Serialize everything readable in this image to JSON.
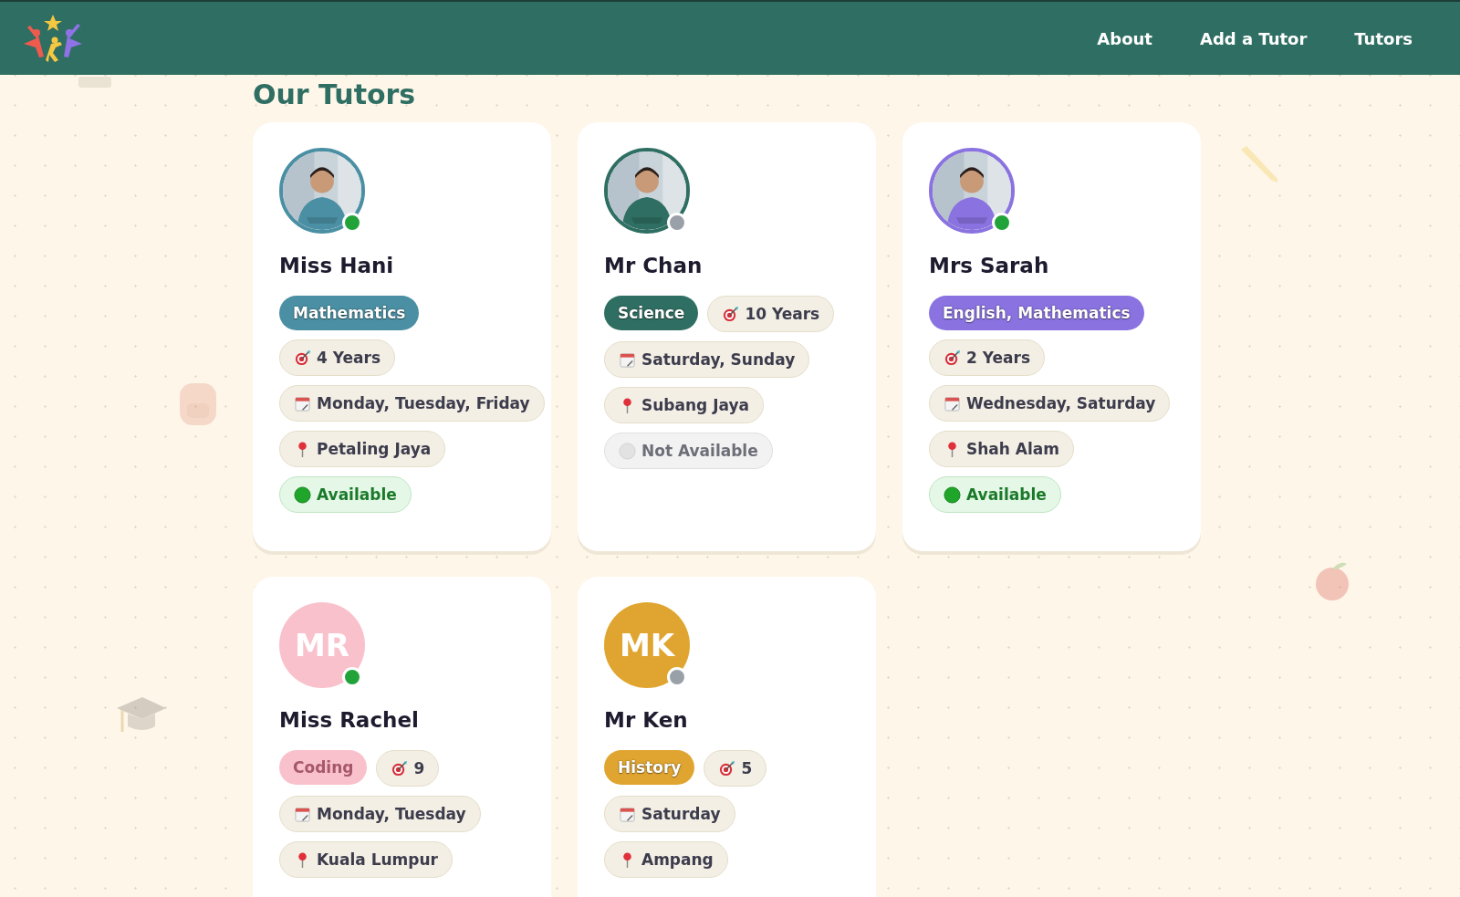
{
  "header": {
    "nav": [
      "About",
      "Add a Tutor",
      "Tutors"
    ]
  },
  "heading": "Our Tutors",
  "tutors": [
    {
      "name": "Miss Hani",
      "avatar": {
        "kind": "picture"
      },
      "color": "#4a8fa3",
      "online": true,
      "rows": [
        [
          {
            "kind": "subject",
            "label": "Mathematics"
          }
        ],
        [
          {
            "kind": "experience",
            "label": "4 Years"
          }
        ],
        [
          {
            "kind": "days",
            "label": "Monday, Tuesday, Friday"
          }
        ],
        [
          {
            "kind": "location",
            "label": "Petaling Jaya"
          }
        ],
        [
          {
            "kind": "status",
            "label": "Available",
            "available": true
          }
        ]
      ]
    },
    {
      "name": "Mr Chan",
      "avatar": {
        "kind": "picture"
      },
      "color": "#2f6e62",
      "online": false,
      "rows": [
        [
          {
            "kind": "subject",
            "label": "Science"
          },
          {
            "kind": "experience",
            "label": "10 Years"
          }
        ],
        [
          {
            "kind": "days",
            "label": "Saturday, Sunday"
          }
        ],
        [
          {
            "kind": "location",
            "label": "Subang Jaya"
          }
        ],
        [
          {
            "kind": "status",
            "label": "Not Available",
            "available": false
          }
        ]
      ]
    },
    {
      "name": "Mrs Sarah",
      "avatar": {
        "kind": "picture"
      },
      "color": "#8a72e0",
      "online": true,
      "rows": [
        [
          {
            "kind": "subject",
            "label": "English, Mathematics"
          }
        ],
        [
          {
            "kind": "experience",
            "label": "2 Years"
          }
        ],
        [
          {
            "kind": "days",
            "label": "Wednesday, Saturday"
          }
        ],
        [
          {
            "kind": "location",
            "label": "Shah Alam"
          }
        ],
        [
          {
            "kind": "status",
            "label": "Available",
            "available": true
          }
        ]
      ]
    },
    {
      "name": "Miss Rachel",
      "avatar": {
        "kind": "initials",
        "initials": "MR"
      },
      "color": "#f9c1cc",
      "online": true,
      "rows": [
        [
          {
            "kind": "subject",
            "label": "Coding"
          },
          {
            "kind": "experience",
            "label": "9"
          }
        ],
        [
          {
            "kind": "days",
            "label": "Monday, Tuesday"
          }
        ],
        [
          {
            "kind": "location",
            "label": "Kuala Lumpur"
          }
        ]
      ]
    },
    {
      "name": "Mr Ken",
      "avatar": {
        "kind": "initials",
        "initials": "MK"
      },
      "color": "#e0a530",
      "online": false,
      "rows": [
        [
          {
            "kind": "subject",
            "label": "History"
          },
          {
            "kind": "experience",
            "label": "5"
          }
        ],
        [
          {
            "kind": "days",
            "label": "Saturday"
          }
        ],
        [
          {
            "kind": "location",
            "label": "Ampang"
          }
        ]
      ]
    }
  ]
}
